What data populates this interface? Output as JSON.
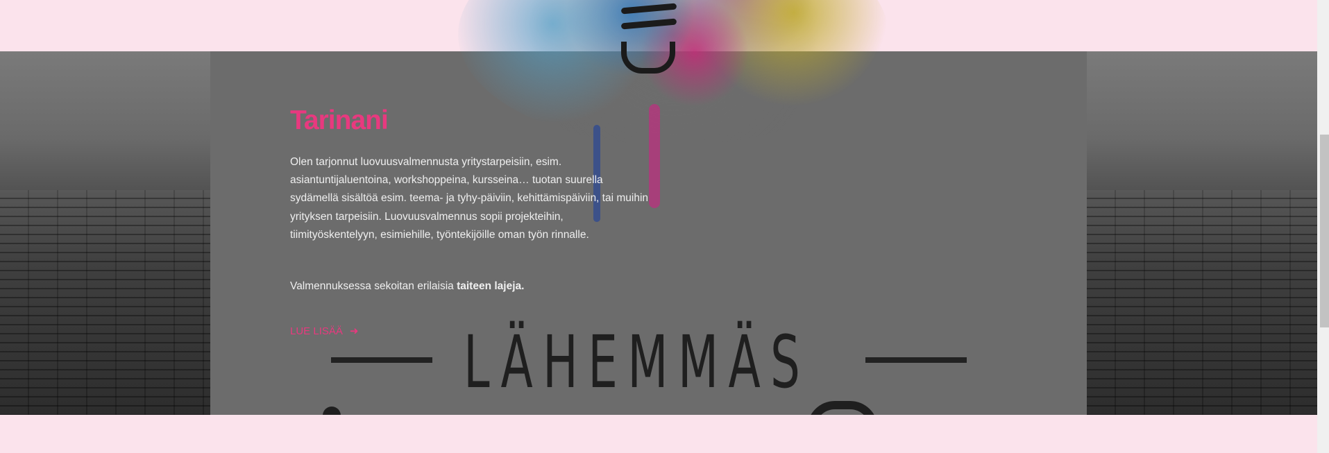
{
  "hero": {
    "title": "Tarinani",
    "paragraph1": "Olen tarjonnut luovuusvalmennusta yritystarpeisiin, esim. asiantuntijaluentoina, workshoppeina, kursseina… tuotan suurella sydämellä sisältöä esim. teema- ja tyhy-päiviin, kehittämispäiviin, tai muihin yrityksen tarpeisiin. Luovuusvalmennus sopii projekteihin, tiimityöskentelyyn, esimiehille, työntekijöille oman työn rinnalle.",
    "paragraph2_prefix": "Valmennuksessa sekoitan erilaisia ",
    "paragraph2_bold": "taiteen lajeja.",
    "read_more_label": "LUE LISÄÄ",
    "read_more_icon": "arrow-right-icon"
  },
  "background_poster": {
    "word": "LÄHEMMÄS"
  },
  "colors": {
    "accent": "#e8397f",
    "page_background": "#fbe3ec",
    "overlay": "#6c6c6c",
    "text": "#efefef"
  }
}
